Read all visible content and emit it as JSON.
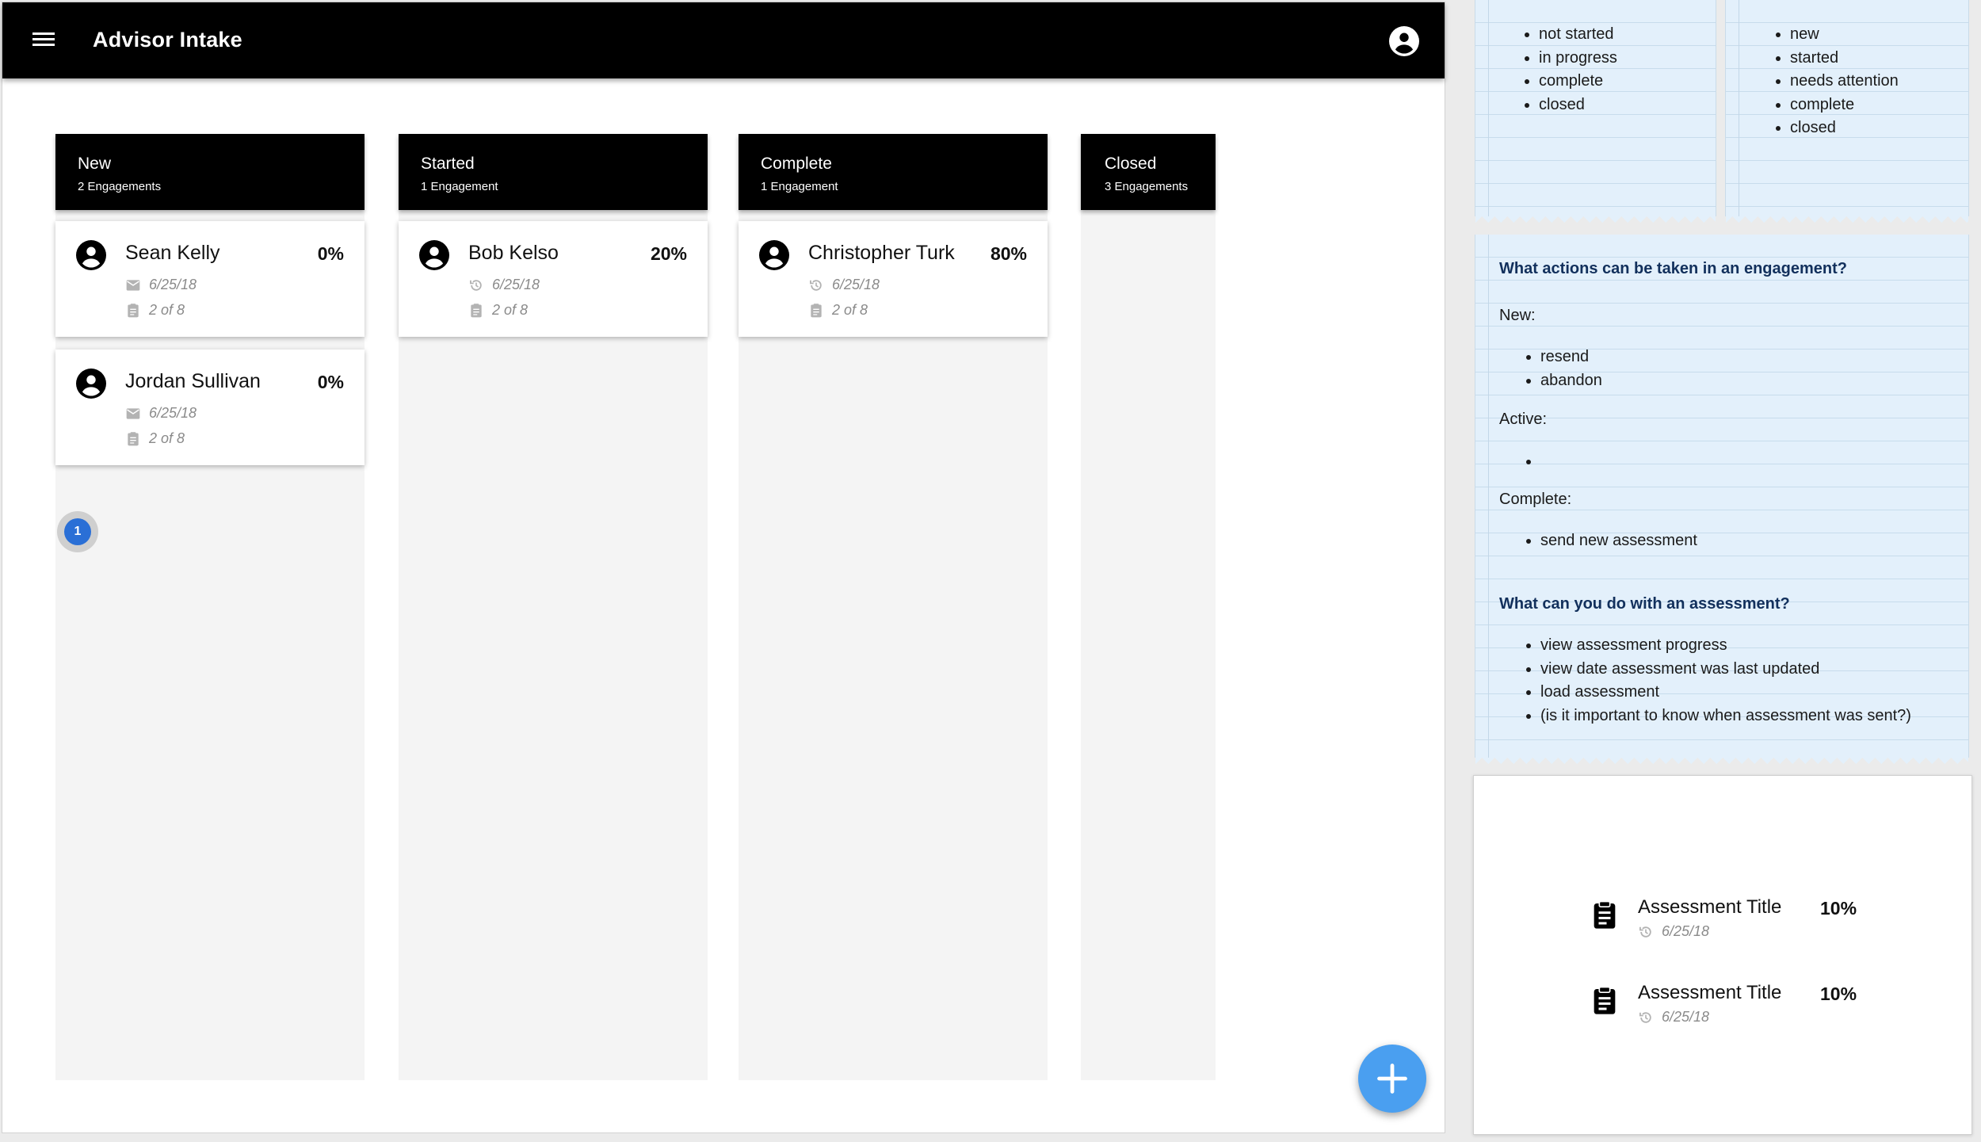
{
  "header": {
    "title": "Advisor Intake",
    "menu_icon": "hamburger-menu-icon",
    "account_icon": "account-circle-icon"
  },
  "columns": [
    {
      "title": "New",
      "count": "2 Engagements",
      "cards": [
        {
          "name": "Sean Kelly",
          "percent": "0%",
          "date": "6/25/18",
          "date_icon": "mail-icon",
          "progress": "2 of 8"
        },
        {
          "name": "Jordan Sullivan",
          "percent": "0%",
          "date": "6/25/18",
          "date_icon": "mail-icon",
          "progress": "2 of 8"
        }
      ]
    },
    {
      "title": "Started",
      "count": "1 Engagement",
      "cards": [
        {
          "name": "Bob Kelso",
          "percent": "20%",
          "date": "6/25/18",
          "date_icon": "history-icon",
          "progress": "2 of 8"
        }
      ]
    },
    {
      "title": "Complete",
      "count": "1 Engagement",
      "cards": [
        {
          "name": "Christopher Turk",
          "percent": "80%",
          "date": "6/25/18",
          "date_icon": "history-icon",
          "progress": "2 of 8"
        }
      ]
    },
    {
      "title": "Closed",
      "count": "3 Engagements",
      "cards": []
    }
  ],
  "page_badge": "1",
  "fab_icon": "plus-icon",
  "notes": {
    "engagement_statuses": [
      "not started",
      "in progress",
      "complete",
      "closed"
    ],
    "assessment_statuses": [
      "new",
      "started",
      "needs attention",
      "complete",
      "closed"
    ],
    "actions": {
      "question": "What actions can be taken in an engagement?",
      "new_label": "New:",
      "new_items": [
        "resend",
        "abandon"
      ],
      "active_label": "Active:",
      "active_items": [
        ""
      ],
      "complete_label": "Complete:",
      "complete_items": [
        "send new assessment"
      ],
      "assessment_question": "What can you do with an assessment?",
      "assessment_items": [
        "view assessment progress",
        "view date assessment was last updated",
        "load assessment",
        "(is it important to know when assessment was sent?)"
      ]
    }
  },
  "assessments": [
    {
      "title": "Assessment Title",
      "percent": "10%",
      "date": "6/25/18"
    },
    {
      "title": "Assessment Title",
      "percent": "10%",
      "date": "6/25/18"
    }
  ],
  "colors": {
    "appbar": "#000000",
    "column_bg": "#f4f4f4",
    "note_bg": "#e3f0fb",
    "fab": "#4a9ff0",
    "badge": "#2a6fd6"
  }
}
